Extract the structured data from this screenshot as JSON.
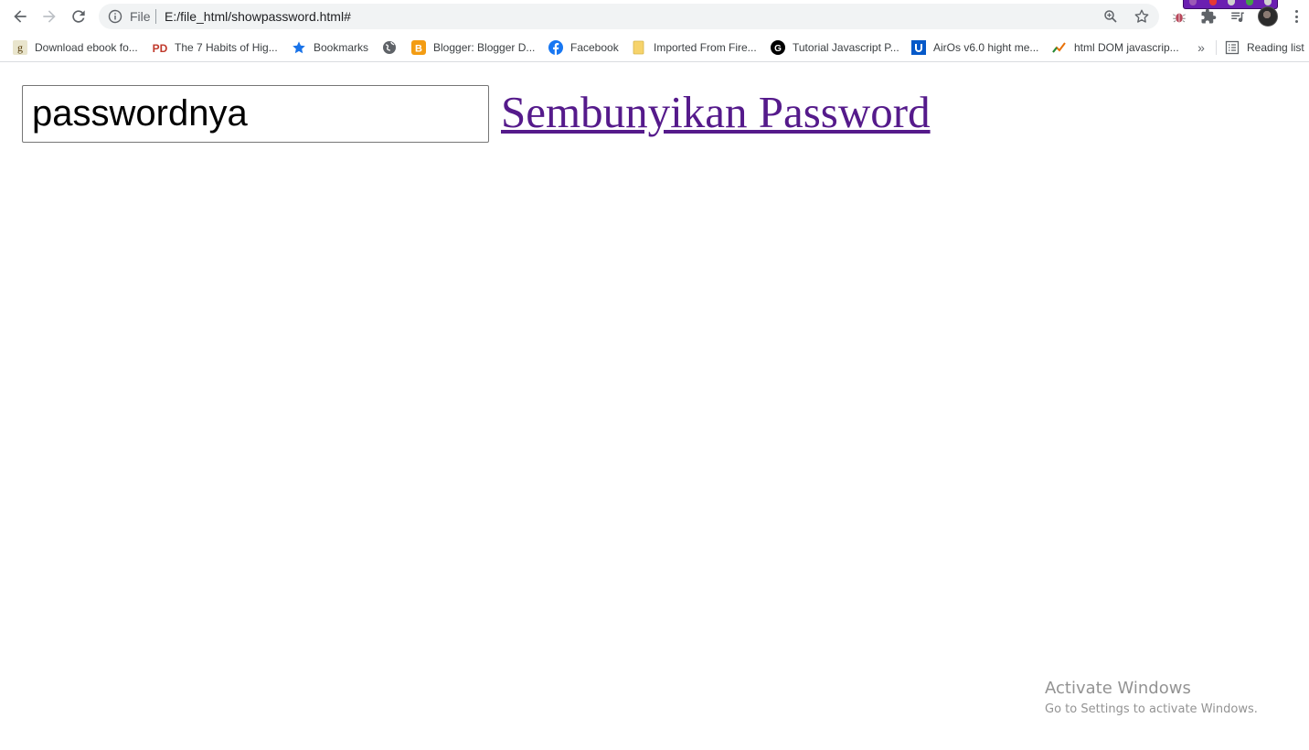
{
  "browser": {
    "scheme_label": "File",
    "url": "E:/file_html/showpassword.html#",
    "bookmarks": [
      {
        "label": "Download ebook fo...",
        "icon": "goodreads-icon",
        "color": "#a5754b"
      },
      {
        "label": "The 7 Habits of Hig...",
        "icon": "pdf-drive-icon",
        "color": "#c0392b"
      },
      {
        "label": "Bookmarks",
        "icon": "star-icon",
        "color": "#1a73e8"
      },
      {
        "label": "",
        "icon": "globe-icon",
        "color": "#5f6368"
      },
      {
        "label": "Blogger: Blogger D...",
        "icon": "blogger-icon",
        "color": "#f39c12"
      },
      {
        "label": "Facebook",
        "icon": "facebook-icon",
        "color": "#1877f2"
      },
      {
        "label": "Imported From Fire...",
        "icon": "folder-icon",
        "color": "#f6d36b"
      },
      {
        "label": "Tutorial Javascript P...",
        "icon": "g-circle-icon",
        "color": "#000000"
      },
      {
        "label": "AirOs v6.0 hight me...",
        "icon": "ubiquiti-icon",
        "color": "#0559c9"
      },
      {
        "label": "html DOM javascrip...",
        "icon": "trend-icon",
        "color": "#e8710a"
      }
    ],
    "reading_list_label": "Reading list"
  },
  "page": {
    "password_value": "passwordnya",
    "toggle_link_label": "Sembunyikan Password"
  },
  "watermark": {
    "title": "Activate Windows",
    "subtitle": "Go to Settings to activate Windows."
  },
  "colors": {
    "link_visited": "#551a8b",
    "omnibox_bg": "#f1f3f4",
    "recorder_bg": "#6b1fb1"
  }
}
